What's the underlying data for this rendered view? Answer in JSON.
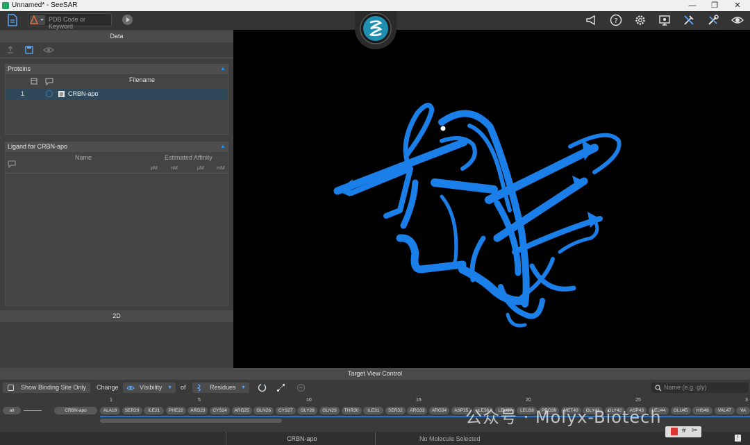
{
  "window": {
    "title": "Unnamed* - SeeSAR",
    "controls": [
      "minimize",
      "restore",
      "close"
    ]
  },
  "toolbar": {
    "search_placeholder": "PDB Code or Keyword",
    "right_icons": [
      "announce-icon",
      "help-icon",
      "settings-icon",
      "display-icon",
      "tools-icon",
      "wrench-icon",
      "eye-icon"
    ]
  },
  "data_panel": {
    "title": "Data",
    "proteins": {
      "title": "Proteins",
      "column": "Filename",
      "rows": [
        {
          "index": "1",
          "name": "CRBN-apo"
        }
      ]
    },
    "ligands": {
      "title": "Ligand for CRBN-apo",
      "col_name": "Name",
      "col_affinity": "Estimated Affinity",
      "units": [
        "pM",
        "nM",
        "µM",
        "mM"
      ]
    },
    "panel_2d": "2D"
  },
  "target_view_control": {
    "title": "Target View Control",
    "show_binding_site": "Show Binding Site Only",
    "change": "Change",
    "visibility": "Visibility",
    "of": "of",
    "residues": "Residues",
    "name_placeholder": "Name (e.g. gly)",
    "all": "all",
    "molecule": "CRBN-apo",
    "seq_numbers": [
      "1",
      "5",
      "10",
      "15",
      "20",
      "25",
      "3"
    ],
    "residues_list": [
      "ALA19",
      "SER20",
      "ILE21",
      "PHE22",
      "ARG23",
      "CYS24",
      "ARG25",
      "GLN26",
      "CYS27",
      "GLY28",
      "GLN29",
      "THR30",
      "ILE31",
      "SER32",
      "ARG33",
      "ARG34",
      "ASP35",
      "ILE36",
      "LEU37",
      "LEU38",
      "PRO39",
      "MET40",
      "GLY41",
      "GLY42",
      "ASP43",
      "LEU44",
      "GLU45",
      "HIS46",
      "VAL47",
      "VA"
    ]
  },
  "status": {
    "protein": "CRBN-apo",
    "selection": "No Molecule Selected"
  },
  "watermark": "公众号 · Molyx-Biotech",
  "colors": {
    "ribbon": "#1a7fe8",
    "background": "#000000",
    "accent": "#1e90ff"
  }
}
